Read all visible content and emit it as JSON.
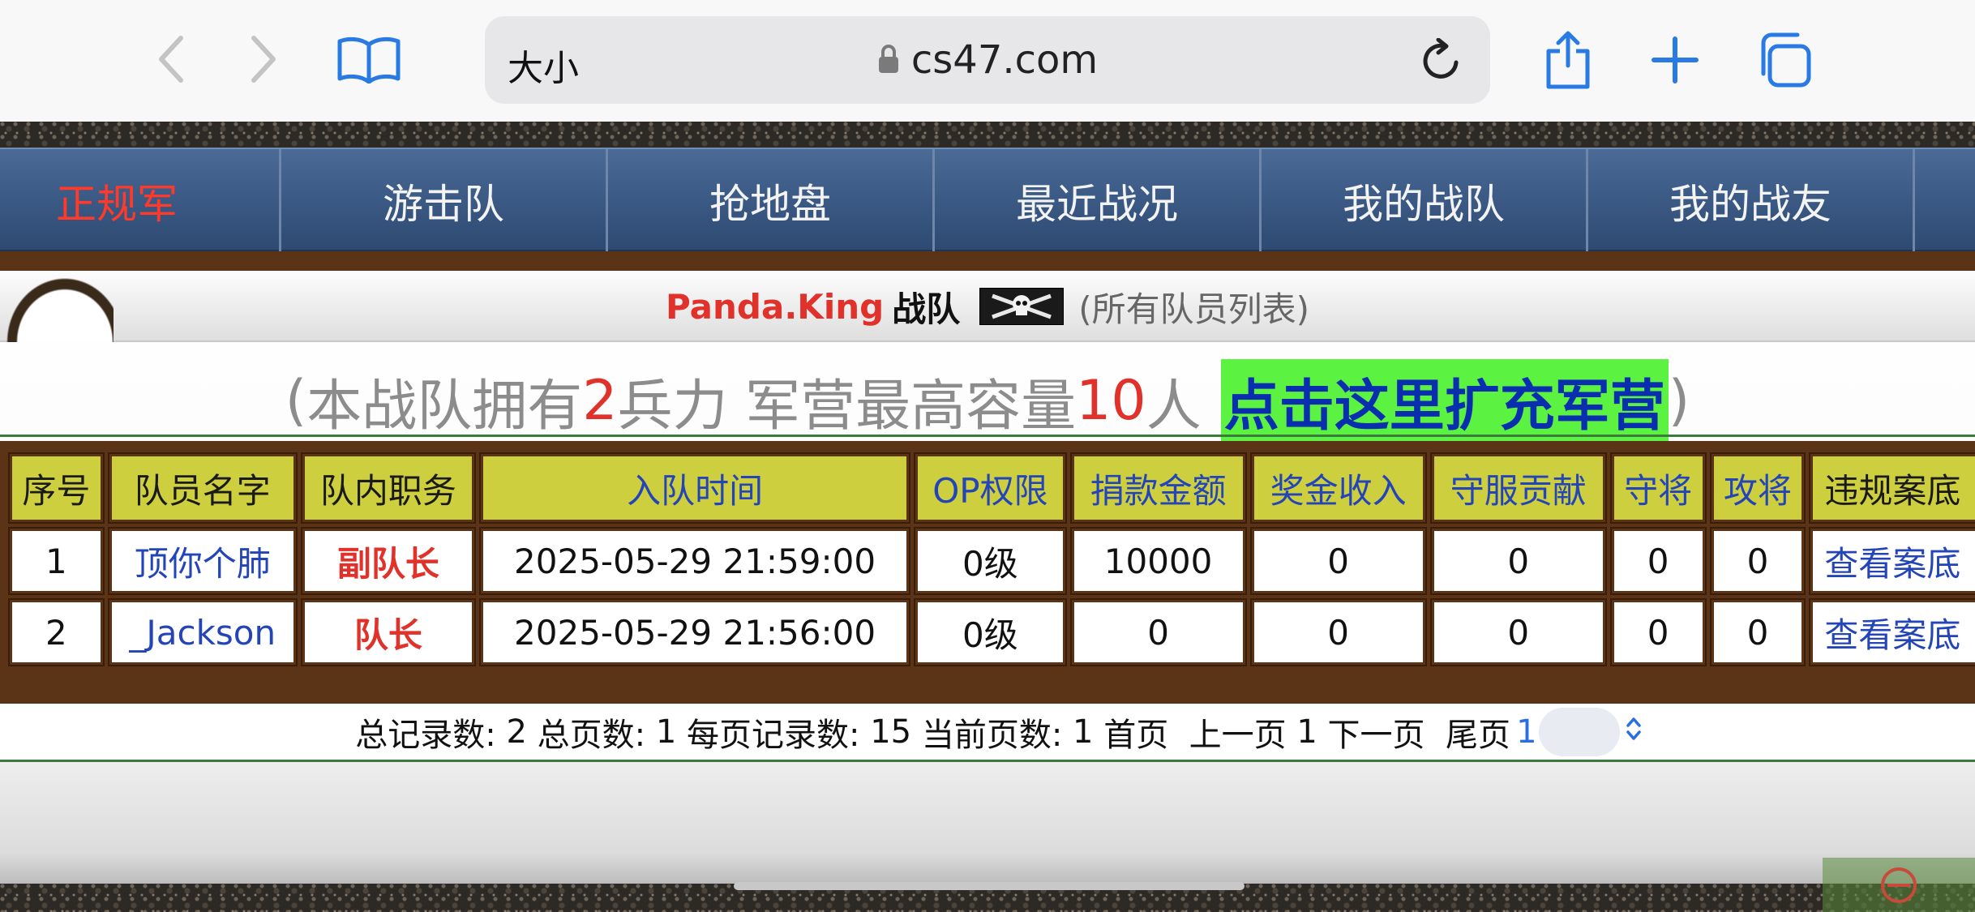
{
  "browser": {
    "text_size_label": "大小",
    "url": "cs47.com",
    "icons": [
      "back-icon",
      "forward-icon",
      "bookmarks-icon",
      "lock-icon",
      "reload-icon",
      "share-icon",
      "new-tab-icon",
      "tabs-icon"
    ]
  },
  "nav": {
    "items": [
      {
        "label": "正规军",
        "active": true
      },
      {
        "label": "游击队",
        "active": false
      },
      {
        "label": "抢地盘",
        "active": false
      },
      {
        "label": "最近战况",
        "active": false
      },
      {
        "label": "我的战队",
        "active": false
      },
      {
        "label": "我的战友",
        "active": false
      }
    ],
    "active_color": "#ff3a2a"
  },
  "team": {
    "name": "Panda.King",
    "suffix": "战队",
    "subtitle": "(所有队员列表)",
    "flag_icon": "skull-crossbones-icon"
  },
  "stats": {
    "open_paren": "(",
    "prefix": "本战队拥有",
    "soldiers": "2",
    "mid": "兵力 军营最高容量",
    "capacity": "10",
    "unit": "人",
    "expand_link": "点击这里扩充军营",
    "close_paren": ")"
  },
  "table": {
    "headers": [
      "序号",
      "队员名字",
      "队内职务",
      "入队时间",
      "OP权限",
      "捐款金额",
      "奖金收入",
      "守服贡献",
      "守将",
      "攻将",
      "违规案底"
    ],
    "rows": [
      [
        "1",
        "顶你个肺",
        "副队长",
        "2025-05-29 21:59:00",
        "0级",
        "10000",
        "0",
        "0",
        "0",
        "0",
        "查看案底"
      ],
      [
        "2",
        "_Jackson",
        "队长",
        "2025-05-29 21:56:00",
        "0级",
        "0",
        "0",
        "0",
        "0",
        "0",
        "查看案底"
      ]
    ]
  },
  "pager": {
    "total_records_label": "总记录数: ",
    "total_records": "2",
    "total_pages_label": " 总页数: ",
    "total_pages": "1",
    "per_page_label": " 每页记录数: ",
    "per_page": "15",
    "current_label": " 当前页数: ",
    "current": "1",
    "first": " 首页 ",
    "prev": " 上一页 ",
    "page_num": "1",
    "next": " 下一页 ",
    "last": " 尾页 ",
    "select_value": "1"
  },
  "colors": {
    "header_bg": "#cdcf3f",
    "frame_brown": "#5b3317",
    "accent_red": "#e0312a",
    "link_blue": "#2445b8",
    "link_highlight": "#5cf242"
  }
}
